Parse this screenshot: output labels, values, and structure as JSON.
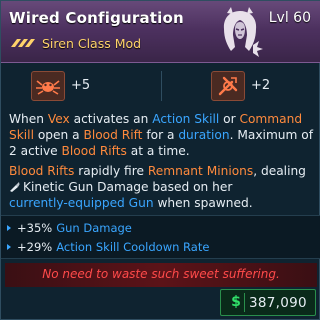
{
  "item": {
    "title": "Wired Configuration",
    "level": "Lvl 60",
    "subtitle": "Siren Class Mod",
    "rarity_icon": "rarity-chevrons-icon",
    "portrait_icon": "vex-portrait-icon"
  },
  "stats": [
    {
      "icon": "skill-tree-icon",
      "value": "+5"
    },
    {
      "icon": "skill-icon",
      "value": "+2"
    }
  ],
  "description": {
    "p1": {
      "t1": "When ",
      "t2": "Vex",
      "t3": " activates an ",
      "t4": "Action Skill",
      "t5": " or ",
      "t6": "Command Skill",
      "t7": " open a ",
      "t8": "Blood Rift",
      "t9": " for a ",
      "t10": "duration",
      "t11": ". Maximum of 2 active ",
      "t12": "Blood Rifts",
      "t13": " at a time."
    },
    "p2": {
      "t1": "Blood Rifts",
      "t2": " rapidly fire ",
      "t3": "Remnant Minions",
      "t4": ", dealing",
      "t5": "Kinetic Gun Damage based on her",
      "t6": "currently-equipped Gun",
      "t7": " when spawned."
    }
  },
  "modifiers": [
    {
      "value": "+35%",
      "text": "Gun Damage"
    },
    {
      "value": "+29%",
      "text": "Action Skill Cooldown Rate"
    }
  ],
  "flavor_text": "No need to waste such sweet suffering.",
  "price": {
    "symbol": "$",
    "value": "387,090"
  },
  "colors": {
    "header": "#4a2f5c",
    "keyword_blue": "#3aa6ff",
    "keyword_orange": "#ff8a3d",
    "flavor_red": "#ff4a4a",
    "price_green": "#31e06a",
    "rarity_gold": "#ffd36a"
  }
}
